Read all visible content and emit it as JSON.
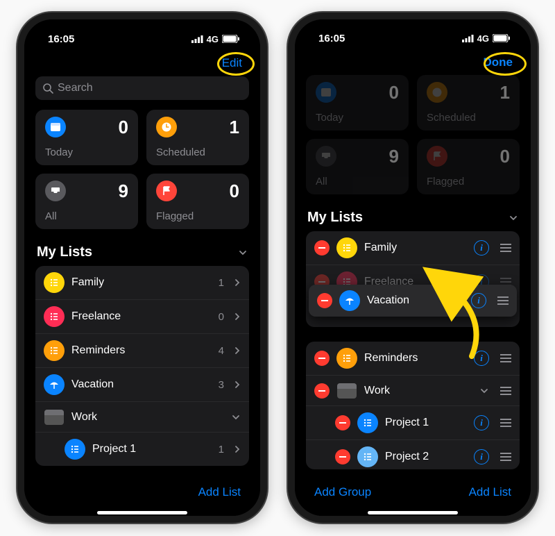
{
  "status": {
    "time": "16:05",
    "network": "4G"
  },
  "left": {
    "action": "Edit",
    "search_placeholder": "Search",
    "cards": {
      "today": {
        "label": "Today",
        "count": "0"
      },
      "scheduled": {
        "label": "Scheduled",
        "count": "1"
      },
      "all": {
        "label": "All",
        "count": "9"
      },
      "flagged": {
        "label": "Flagged",
        "count": "0"
      }
    },
    "section_title": "My Lists",
    "lists": [
      {
        "label": "Family",
        "count": "1"
      },
      {
        "label": "Freelance",
        "count": "0"
      },
      {
        "label": "Reminders",
        "count": "4"
      },
      {
        "label": "Vacation",
        "count": "3"
      },
      {
        "label": "Work"
      },
      {
        "label": "Project 1",
        "count": "1"
      }
    ],
    "footer": {
      "add_list": "Add List"
    }
  },
  "right": {
    "action": "Done",
    "cards": {
      "today": {
        "label": "Today",
        "count": "0"
      },
      "scheduled": {
        "label": "Scheduled",
        "count": "1"
      },
      "all": {
        "label": "All",
        "count": "9"
      },
      "flagged": {
        "label": "Flagged",
        "count": "0"
      }
    },
    "section_title": "My Lists",
    "group1": [
      {
        "label": "Family"
      },
      {
        "label": "Freelance"
      }
    ],
    "dragging": {
      "label": "Vacation"
    },
    "group2": [
      {
        "label": "Reminders"
      },
      {
        "label": "Work"
      },
      {
        "label": "Project 1"
      },
      {
        "label": "Project 2"
      }
    ],
    "footer": {
      "add_group": "Add Group",
      "add_list": "Add List"
    },
    "info_glyph": "i"
  }
}
